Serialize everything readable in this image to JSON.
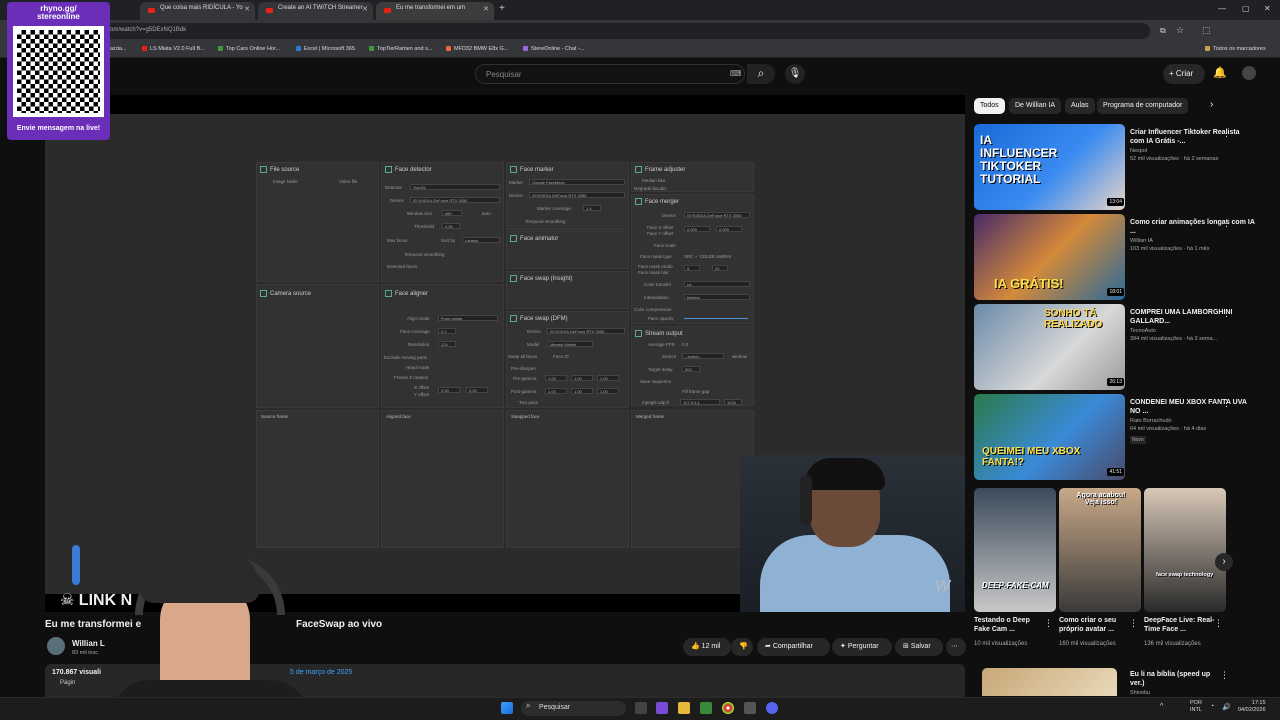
{
  "overlay": {
    "title": "rhyno.gg/\nstereonline",
    "message": "Envie mensagem na live!"
  },
  "browser": {
    "tabs": [
      {
        "label": "Que coisa mais RIDÍCULA - Yo"
      },
      {
        "label": "Create an AI TWITCH Streamer"
      },
      {
        "label": "Eu me transformei em um"
      }
    ],
    "url": "om/watch?v=g5DExNQ1Bdk",
    "bookmarks": [
      "azda...",
      "LS Miata V2.0 Full B...",
      "Top Cars Online Hor...",
      "Excel | Microsoft 365",
      "TopTierRamen and s...",
      "MFD32 BMW E8x G...",
      "StereOnline - Chat -..."
    ],
    "all_bookmarks": "Todos os marcadores"
  },
  "youtube": {
    "search_placeholder": "Pesquisar",
    "create_label": "Criar",
    "video": {
      "title_left": "Eu me transformei e",
      "title_right": "FaceSwap ao vivo",
      "channel": "Willian L",
      "subs": "83 mil insc",
      "views": "170.867 visuali",
      "date": "5 de março de 2025",
      "desc_more": "Págin",
      "likes": "12 mil",
      "share": "Compartilhar",
      "ask": "Perguntar",
      "save": "Salvar",
      "logo_text": "LINK N",
      "watermark": "W"
    },
    "chips": [
      "Todos",
      "De Willian IA",
      "Aulas",
      "Programa de computador"
    ],
    "recommendations": [
      {
        "title": "Criar Influencer Tiktoker Realista com IA Grátis -...",
        "channel": "Nespol",
        "meta": "52 mil visualizações · há 2 semanas",
        "duration": "13:04",
        "thumb_text": "IA INFLUENCER TIKTOKER TUTORIAL"
      },
      {
        "title": "Como criar animações longas com IA ...",
        "channel": "Willian IA",
        "meta": "103 mil visualizações · há 1 mês",
        "duration": "18:01",
        "thumb_text": "IA GRÁTIS!"
      },
      {
        "title": "COMPREI UMA LAMBORGHINI GALLARD...",
        "channel": "TecnoAuto",
        "meta": "394 mil visualizações · há 3 sema...",
        "duration": "26:13",
        "thumb_text": "SONHO TÁ REALIZADO"
      },
      {
        "title": "CONDENEI MEU XBOX FANTA UVA NO ...",
        "channel": "Rato Borrachudo",
        "meta": "64 mil visualizações · há 4 dias",
        "duration": "41:51",
        "badge": "Novo",
        "thumb_text": "QUEIMEI MEU XBOX FANTA!?"
      }
    ],
    "shorts": [
      {
        "title": "Testando o Deep Fake Cam ...",
        "meta": "10 mil visualizações",
        "thumb_text": "DEEP-FAKE-CAM"
      },
      {
        "title": "Como criar o seu próprio avatar ...",
        "meta": "160 mil visualizações",
        "thumb_text": "Agora acabou! Veja isso!"
      },
      {
        "title": "DeepFace Live: Real-Time Face ...",
        "meta": "136 mil visualizações",
        "thumb_text": "face swap technology"
      }
    ],
    "next_rec": {
      "title": "Eu li na bíblia (speed up ver.)",
      "channel": "Shinobu"
    }
  },
  "app": {
    "panels": {
      "file_source": "File source",
      "face_detector": "Face detector",
      "face_marker": "Face marker",
      "frame_adjuster": "Frame adjuster",
      "face_merger": "Face merger",
      "face_animator": "Face animator",
      "face_swap_insight": "Face swap (Insight)",
      "camera_source": "Camera source",
      "face_aligner": "Face aligner",
      "face_swap_dfm": "Face swap (DFM)",
      "stream_output": "Stream output",
      "source_frame": "Source frame",
      "aligned_face": "Aligned face",
      "swapped_face": "Swapped face",
      "merged_frame": "Merged frame"
    },
    "labels": {
      "image_folder": "Image folder",
      "video_file": "Video file",
      "detector": "Detector",
      "detector_val": "YoloV5",
      "device": "Device",
      "device_val": "[0] NVIDIA GeForce RTX 3050",
      "window_size": "Window size",
      "window_val": "480",
      "auto": "auto",
      "threshold": "Threshold",
      "threshold_val": "0.50",
      "max_faces": "Max faces",
      "sort_by": "Sort by",
      "sort_val": "Largest",
      "temporal_smoothing": "Temporal smoothing",
      "detected_faces": "Detected faces",
      "marker": "Marker",
      "marker_val": "Google FaceMesh",
      "marker_coverage": "Marker coverage",
      "marker_cov_val": "1.4",
      "median_blur": "Median blur",
      "degrade_bicubic": "Degrade bicubic",
      "face_x_offset": "Face X offset",
      "face_y_offset": "Face Y offset",
      "offset_val": "0.000",
      "face_scale": "Face scale",
      "face_mask_type": "Face mask type",
      "mask_opts": "SRC ✓ CELEB LMRKS",
      "face_mask_erode": "Face mask erode",
      "face_mask_blur": "Face mask blur",
      "erode_val": "5",
      "blur_val": "25",
      "color_transfer": "Color transfer",
      "color_val": "rct",
      "interpolation": "Interpolation",
      "interp_val": "bilinear",
      "color_compression": "Color compression",
      "face_opacity": "Face opacity",
      "align_mode": "Align mode",
      "align_val": "From points",
      "face_coverage": "Face coverage",
      "coverage_val": "2.2",
      "resolution": "Resolution",
      "resolution_val": "224",
      "exclude_moving": "Exclude moving parts",
      "head_mode": "Head mode",
      "freeze_z": "Freeze Z rotation",
      "x_offset": "X offset",
      "y_offset": "Y offset",
      "zero": "0.00",
      "model": "Model",
      "model_val": "Meggie Merkel",
      "swap_all": "Swap all faces",
      "face_id": "Face ID",
      "pre_sharpen": "Pre-sharpen",
      "pre_gamma": "Pre-gamma",
      "post_gamma": "Post-gamma",
      "two_pass": "Two pass",
      "one": "1.00",
      "avg_fps": "Average FPS",
      "avg_val": "0.0",
      "source": "Source",
      "source_val": "--select--",
      "window": "window",
      "target_delay": "Target delay",
      "target_val": "500",
      "save_sequence": "Save sequence",
      "fill_frame": "Fill frame gap",
      "mpegts": "mpegts udp://",
      "ip_val": "127.0.0.1",
      "port_val": "1234"
    }
  },
  "taskbar": {
    "search": "Pesquisar",
    "lang": "POR\nINTL",
    "time": "17:15",
    "date": "04/02/2026"
  },
  "colors": {
    "overlay": "#6a2eb8",
    "accent_link": "#3ea6ff",
    "yt_red": "#e62117"
  }
}
